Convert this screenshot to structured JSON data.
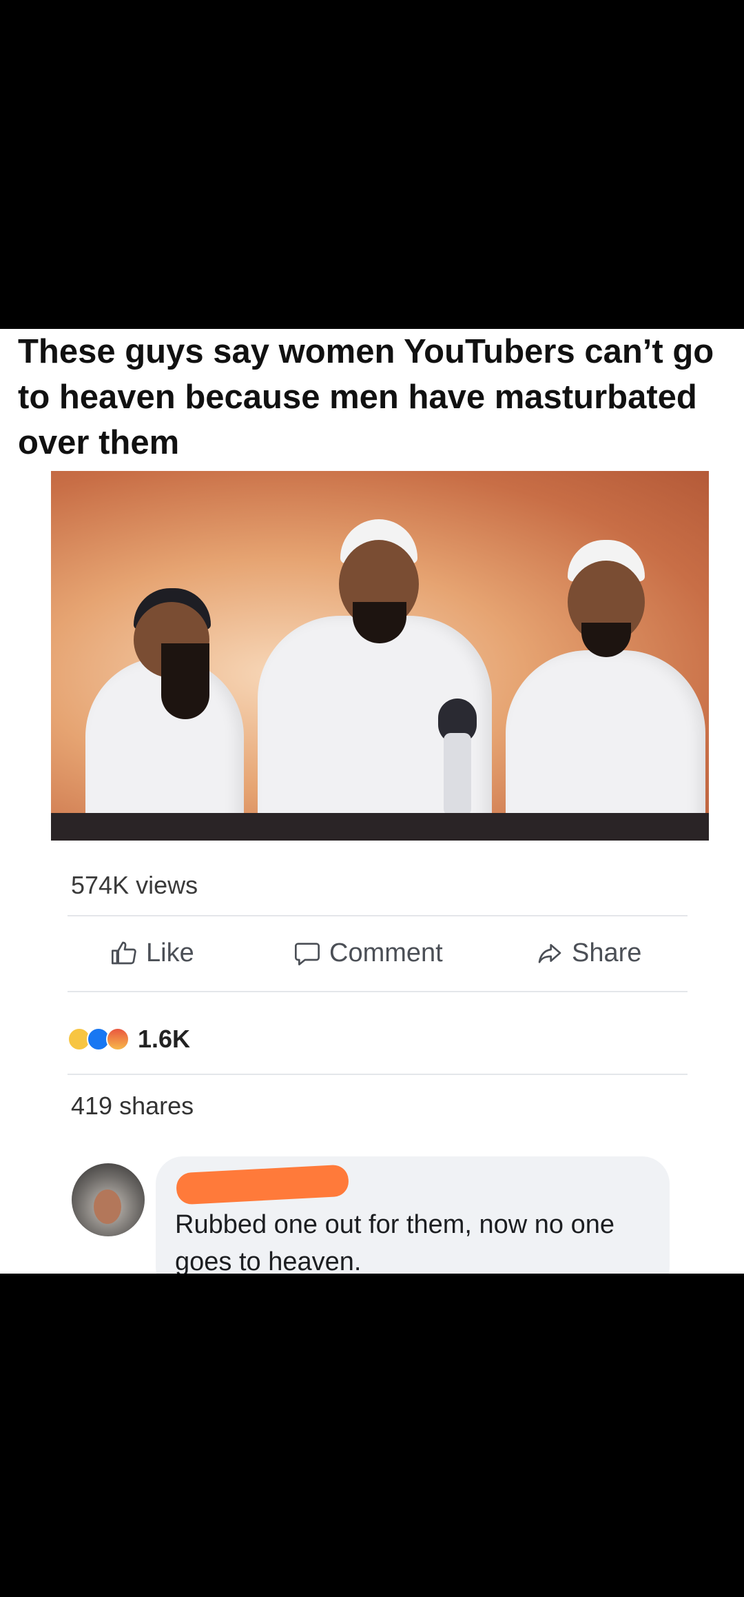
{
  "caption": {
    "text": "These guys say women YouTubers can’t go to heaven because men have masturbated over them"
  },
  "video": {
    "views": "574K views"
  },
  "actions": {
    "like": "Like",
    "comment": "Comment",
    "share": "Share"
  },
  "reactions": {
    "count": "1.6K",
    "icons": [
      "haha-icon",
      "like-icon",
      "angry-icon"
    ]
  },
  "shares": "419 shares",
  "comment": {
    "text": "Rubbed one out for them, now no one goes to heaven."
  },
  "colors": {
    "page_background": "#000000",
    "card_background": "#ffffff",
    "comment_bubble": "#f0f2f5",
    "redaction": "#ff7a3a",
    "action_gray": "#4b4f56"
  }
}
